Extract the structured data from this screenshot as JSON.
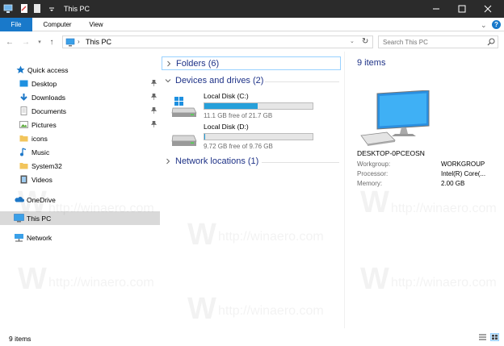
{
  "window": {
    "title": "This PC"
  },
  "ribbon": {
    "tabs": [
      "File",
      "Computer",
      "View"
    ],
    "help": "?"
  },
  "address": {
    "path": "This PC"
  },
  "search": {
    "placeholder": "Search This PC"
  },
  "sidebar": {
    "quick_access": "Quick access",
    "pinned": [
      {
        "label": "Desktop",
        "icon": "desktop-folder-icon"
      },
      {
        "label": "Downloads",
        "icon": "downloads-folder-icon"
      },
      {
        "label": "Documents",
        "icon": "documents-folder-icon"
      },
      {
        "label": "Pictures",
        "icon": "pictures-folder-icon"
      }
    ],
    "recent": [
      {
        "label": "icons",
        "icon": "folder-icon"
      },
      {
        "label": "Music",
        "icon": "music-icon"
      },
      {
        "label": "System32",
        "icon": "folder-icon"
      },
      {
        "label": "Videos",
        "icon": "videos-icon"
      }
    ],
    "onedrive": "OneDrive",
    "this_pc": "This PC",
    "network": "Network"
  },
  "main": {
    "groups": {
      "folders": "Folders (6)",
      "devices": "Devices and drives (2)",
      "network": "Network locations (1)"
    },
    "drives": [
      {
        "name": "Local Disk (C:)",
        "free": "11.1 GB free of 21.7 GB",
        "used_fraction": 0.49
      },
      {
        "name": "Local Disk (D:)",
        "free": "9.72 GB free of 9.76 GB",
        "used_fraction": 0.004
      }
    ]
  },
  "details": {
    "count": "9 items",
    "pc_name": "DESKTOP-0PCEOSN",
    "props": [
      {
        "label": "Workgroup:",
        "value": "WORKGROUP"
      },
      {
        "label": "Processor:",
        "value": "Intel(R) Core(..."
      },
      {
        "label": "Memory:",
        "value": "2.00 GB"
      }
    ]
  },
  "status": {
    "text": "9 items"
  },
  "watermark": {
    "url": "http://winaero.com",
    "logo": "W"
  },
  "colors": {
    "accent": "#1979ca",
    "drive_bar": "#26a0da",
    "group_text": "#1e3287",
    "selection": "#d9d9d9"
  }
}
